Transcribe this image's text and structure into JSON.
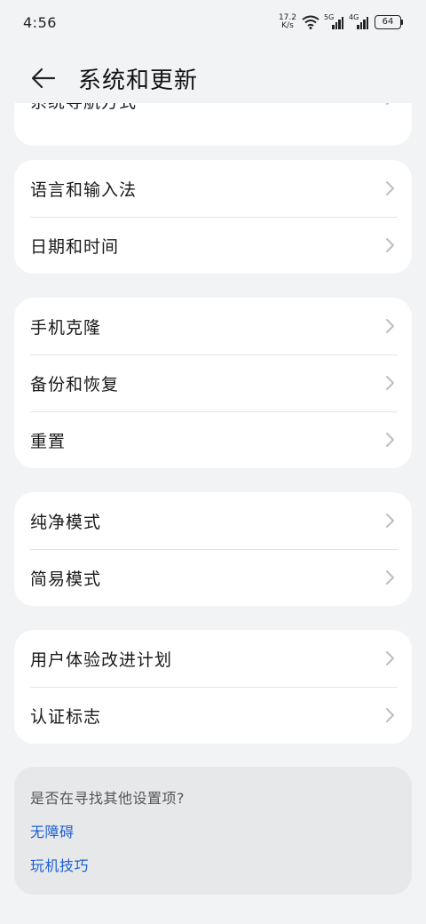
{
  "status_bar": {
    "time": "4:56",
    "net_speed_value": "17.2",
    "net_speed_unit": "K/s",
    "signal1_label": "5G",
    "signal2_label": "4G",
    "battery": "64"
  },
  "header": {
    "title": "系统和更新"
  },
  "partial_item": {
    "label": "系统导航方式"
  },
  "groups": [
    {
      "items": [
        "语言和输入法",
        "日期和时间"
      ]
    },
    {
      "items": [
        "手机克隆",
        "备份和恢复",
        "重置"
      ]
    },
    {
      "items": [
        "纯净模式",
        "简易模式"
      ]
    },
    {
      "items": [
        "用户体验改进计划",
        "认证标志"
      ]
    }
  ],
  "hint": {
    "question": "是否在寻找其他设置项?",
    "links": [
      "无障碍",
      "玩机技巧"
    ]
  },
  "colors": {
    "background": "#f1f3f5",
    "card": "#ffffff",
    "link": "#1c5fd6"
  }
}
